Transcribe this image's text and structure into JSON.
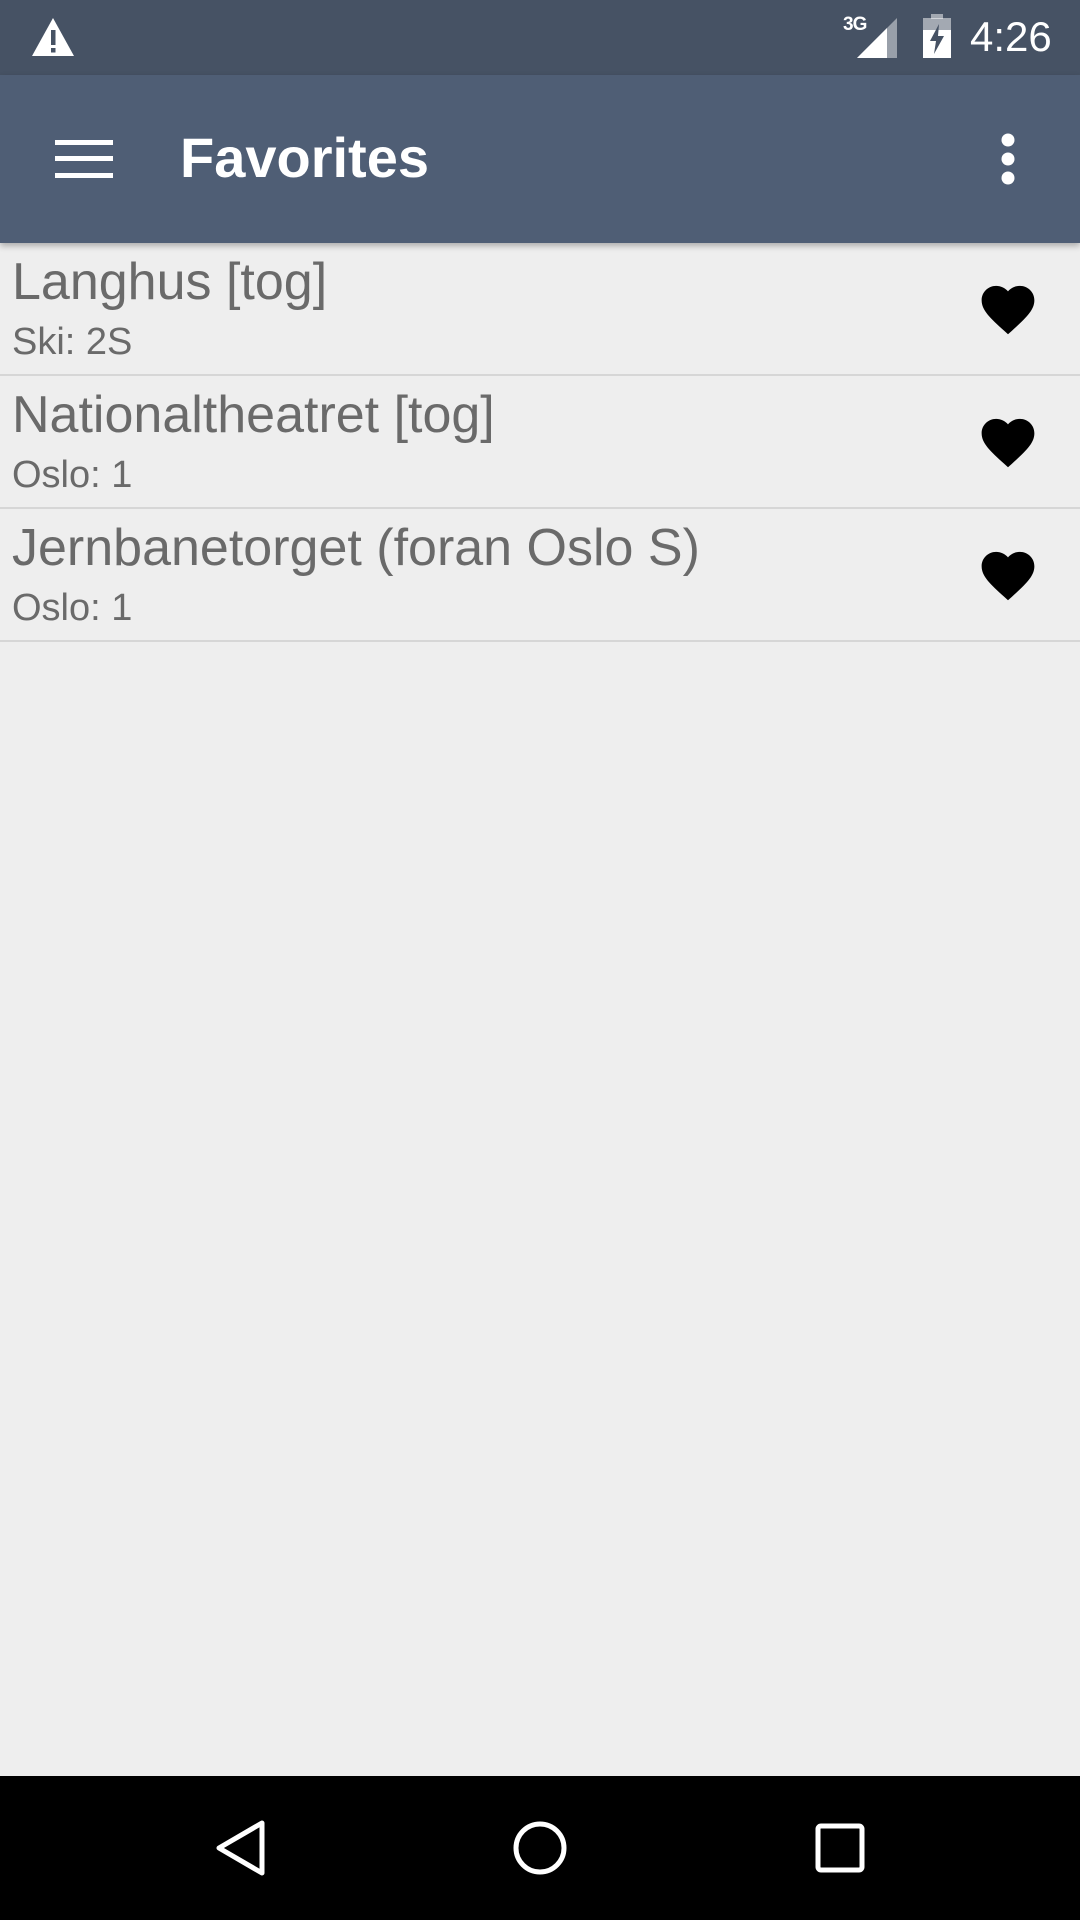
{
  "status_bar": {
    "network_type": "3G",
    "time": "4:26",
    "icons": [
      "warning-icon",
      "signal-icon",
      "battery-charging-icon"
    ]
  },
  "app_bar": {
    "title": "Favorites",
    "icons": [
      "menu-icon",
      "more-vert-icon"
    ]
  },
  "favorites": [
    {
      "name": "Langhus [tog]",
      "detail": "Ski: 2S",
      "icon": "heart-icon"
    },
    {
      "name": "Nationaltheatret [tog]",
      "detail": "Oslo: 1",
      "icon": "heart-icon"
    },
    {
      "name": "Jernbanetorget (foran Oslo S)",
      "detail": "Oslo: 1",
      "icon": "heart-icon"
    }
  ],
  "nav_bar": {
    "icons": [
      "back-icon",
      "home-icon",
      "recents-icon"
    ]
  },
  "colors": {
    "status_bar": "#465264",
    "app_bar": "#4f5e75",
    "background": "#eeeeee",
    "item_text": "#6a6a6a"
  }
}
